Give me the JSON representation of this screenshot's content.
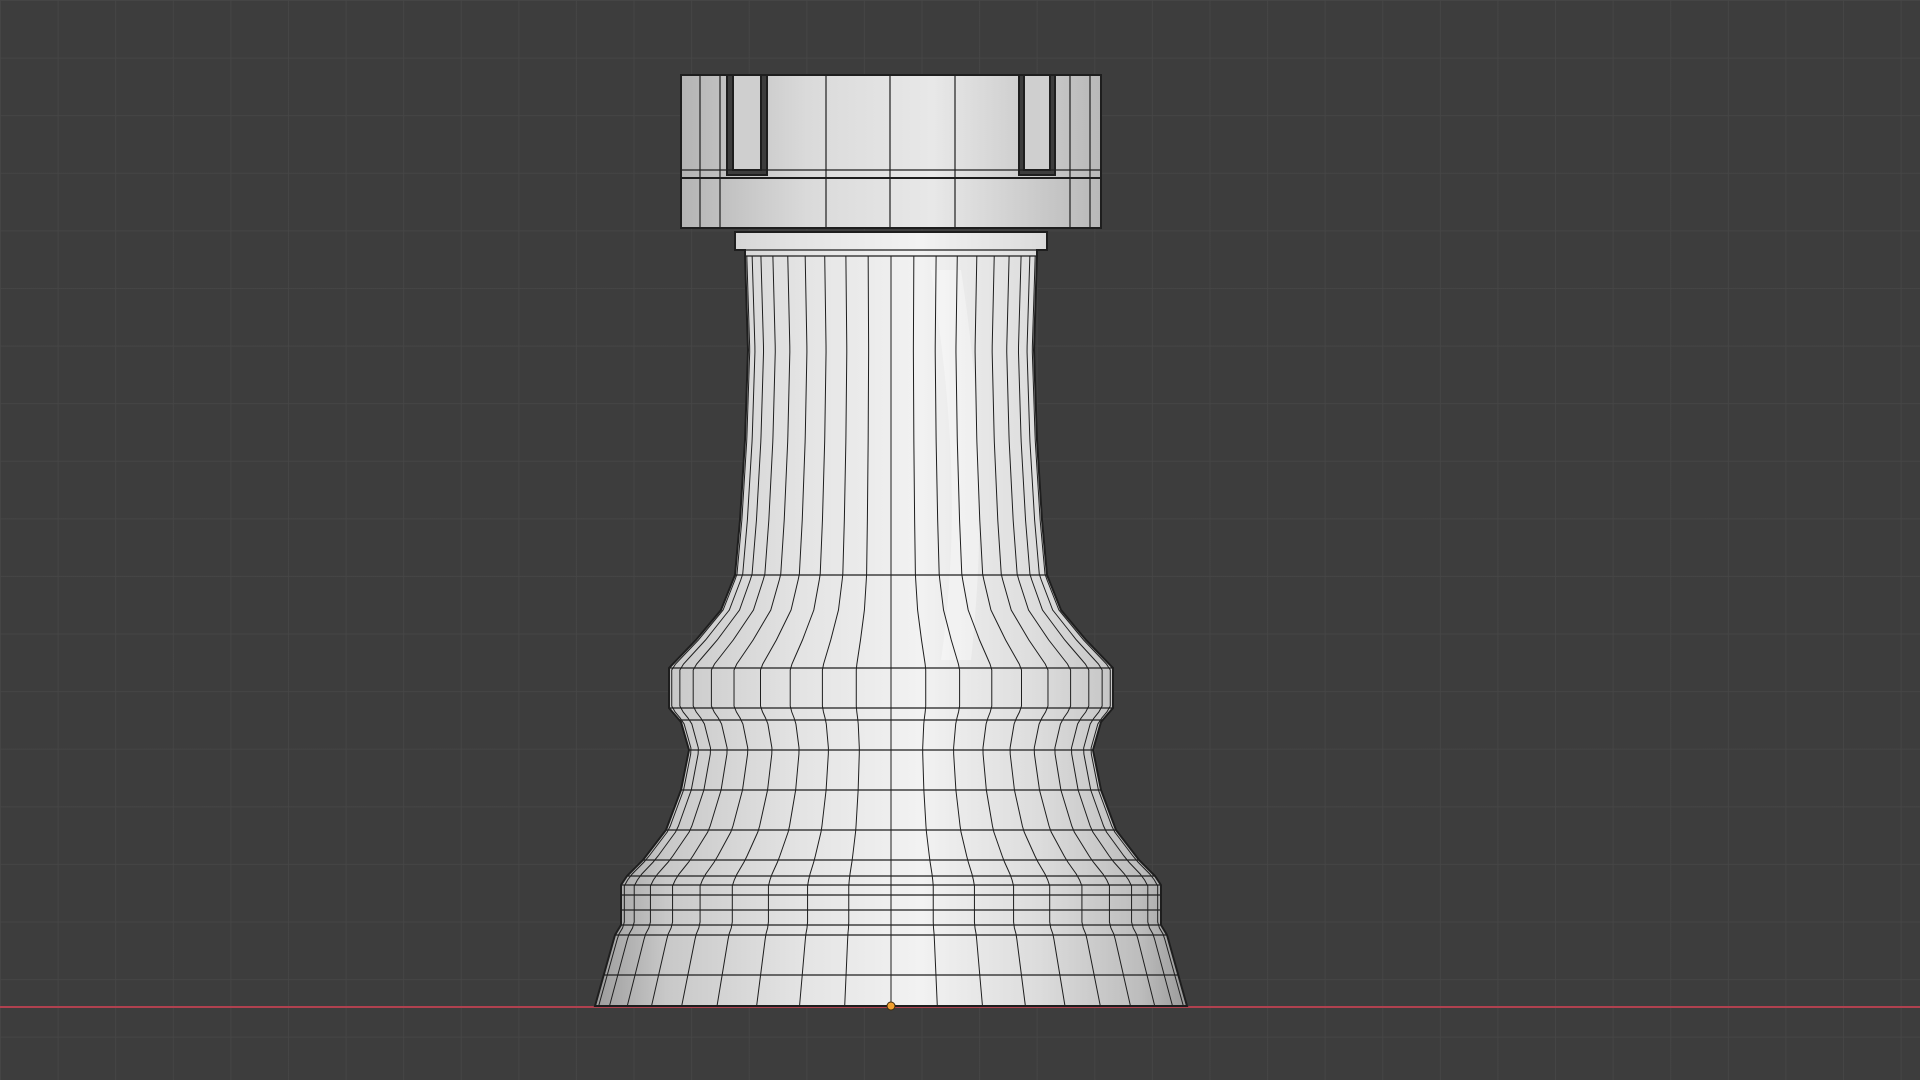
{
  "viewport": {
    "background_color": "#3d3d3d",
    "grid_color": "#474747",
    "x_axis_color": "#b0414f",
    "origin_color": "#f0a030"
  },
  "object": {
    "type": "chess-rook",
    "shading": "solid-with-wireframe",
    "mesh_color": "#d8d8d8",
    "wire_color": "#1e1e1e"
  }
}
